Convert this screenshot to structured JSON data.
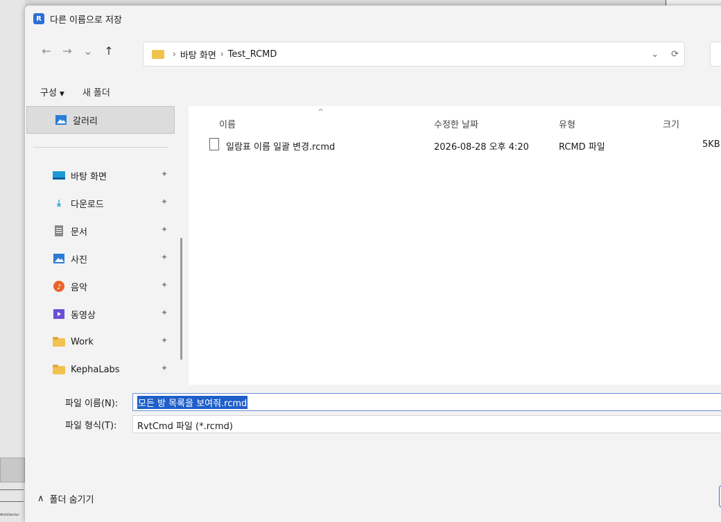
{
  "window": {
    "title": "다른 이름으로 저장",
    "app_icon_letter": "R",
    "accent": "#2b6fd6"
  },
  "nav": {
    "back_icon": "←",
    "forward_icon": "→",
    "recent_icon": "⌄",
    "up_icon": "↑",
    "breadcrumb": [
      "바탕 화면",
      "Test_RCMD"
    ],
    "refresh_icon": "⟳",
    "dropdown_icon": "⌄"
  },
  "toolbar": {
    "organize_label": "구성",
    "new_folder_label": "새 폴더"
  },
  "sidebar": {
    "gallery_label": "갈러리",
    "items": [
      {
        "label": "바탕 화면",
        "icon": "desktop-icon"
      },
      {
        "label": "다운로드",
        "icon": "download-icon"
      },
      {
        "label": "문서",
        "icon": "document-icon"
      },
      {
        "label": "사진",
        "icon": "picture-icon"
      },
      {
        "label": "음악",
        "icon": "music-icon"
      },
      {
        "label": "동영상",
        "icon": "video-icon"
      },
      {
        "label": "Work",
        "icon": "folder-icon"
      },
      {
        "label": "KephaLabs",
        "icon": "folder-icon"
      }
    ]
  },
  "table": {
    "columns": [
      "이름",
      "수정한 날짜",
      "유형",
      "크기"
    ],
    "rows": [
      {
        "name": "일람표 이름 일괄 변경.rcmd",
        "modified": "2026-08-28 오후 4:20",
        "type": "RCMD 파일",
        "size": "5KB"
      }
    ]
  },
  "save": {
    "filename_label": "파일 이름(N):",
    "filename_value": "모든 방 목록을 보여줘.rcmd",
    "filetype_label": "파일 형식(T):",
    "filetype_value": "RvtCmd 파일 (*.rcmd)"
  },
  "footer": {
    "toggle_label": "폴더 숨기기"
  },
  "background": {
    "tiny_text": "Architectur"
  }
}
